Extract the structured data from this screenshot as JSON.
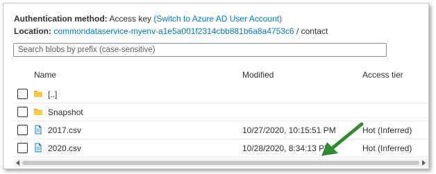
{
  "header": {
    "auth_label": "Authentication method:",
    "auth_value": "Access key",
    "auth_link": "(Switch to Azure AD User Account)",
    "location_label": "Location:",
    "location_link": "commondataservice-myenv-a1e5a001f2314cbb881b6a8a4753c6",
    "location_sep": "/",
    "location_path": "contact"
  },
  "search": {
    "placeholder": "Search blobs by prefix (case-sensitive)"
  },
  "table": {
    "columns": [
      "Name",
      "Modified",
      "Access tier"
    ],
    "rows": [
      {
        "name": "[..]",
        "modified": "",
        "tier": "",
        "icon": "folder-icon"
      },
      {
        "name": "Snapshot",
        "modified": "",
        "tier": "",
        "icon": "folder-icon"
      },
      {
        "name": "2017.csv",
        "modified": "10/27/2020, 10:15:51 PM",
        "tier": "Hot (Inferred)",
        "icon": "file-icon"
      },
      {
        "name": "2020.csv",
        "modified": "10/28/2020, 8:34:13 PM",
        "tier": "Hot (Inferred)",
        "icon": "file-icon"
      }
    ]
  },
  "colors": {
    "link": "#0078d4",
    "folder": "#ffc83d",
    "file": "#0078d4",
    "annotation_arrow": "#2e8b2e"
  }
}
